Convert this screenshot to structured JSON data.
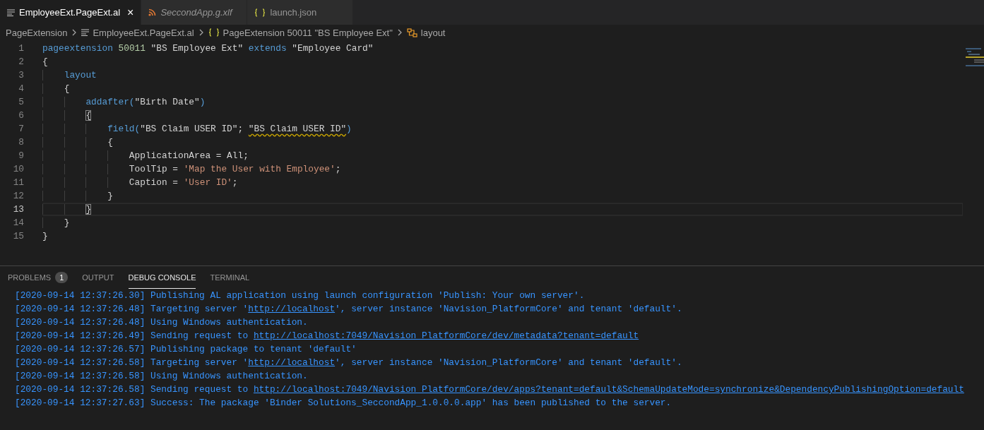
{
  "tabs": [
    {
      "kind": "lines",
      "label": "EmployeeExt.PageExt.al",
      "selected": true,
      "preview": false,
      "close": "×"
    },
    {
      "kind": "rss",
      "label": "SeccondApp.g.xlf",
      "selected": false,
      "preview": true
    },
    {
      "kind": "braces",
      "label": "launch.json",
      "selected": false,
      "preview": false
    }
  ],
  "breadcrumbs": [
    {
      "kind": "plain",
      "label": "PageExtension"
    },
    {
      "kind": "lines",
      "label": "EmployeeExt.PageExt.al"
    },
    {
      "kind": "braces",
      "label": "PageExtension 50011 \"BS Employee Ext\""
    },
    {
      "kind": "tree",
      "label": "layout"
    }
  ],
  "editor": {
    "lines": [
      {
        "number": "1",
        "current": false,
        "tokens": [
          {
            "kind": "keyword",
            "text": "pageextension"
          },
          {
            "kind": "number",
            "text": " 50011"
          },
          {
            "kind": "plain",
            "text": " \"BS Employee Ext\" "
          },
          {
            "kind": "keyword",
            "text": "extends"
          },
          {
            "kind": "plain",
            "text": " \"Employee Card\""
          }
        ]
      },
      {
        "number": "2",
        "current": false,
        "tokens": [
          {
            "kind": "plain",
            "text": "{"
          }
        ]
      },
      {
        "number": "3",
        "current": false,
        "tokens": [
          {
            "kind": "keyword",
            "text": "    layout"
          }
        ]
      },
      {
        "number": "4",
        "current": false,
        "tokens": [
          {
            "kind": "plain",
            "text": "    {"
          }
        ]
      },
      {
        "number": "5",
        "current": false,
        "tokens": [
          {
            "kind": "keyword",
            "text": "        addafter("
          },
          {
            "kind": "plain",
            "text": "\"Birth Date\""
          },
          {
            "kind": "keyword",
            "text": ")"
          }
        ]
      },
      {
        "number": "6",
        "current": false,
        "tokens": [
          {
            "kind": "match",
            "text": "        {"
          }
        ]
      },
      {
        "number": "7",
        "current": false,
        "tokens": [
          {
            "kind": "keyword",
            "text": "            field("
          },
          {
            "kind": "plain",
            "text": "\"BS Claim USER ID\"; "
          },
          {
            "kind": "warning",
            "text": "\"BS Claim USER ID\""
          },
          {
            "kind": "keyword",
            "text": ")"
          }
        ]
      },
      {
        "number": "8",
        "current": false,
        "tokens": [
          {
            "kind": "plain",
            "text": "            {"
          }
        ]
      },
      {
        "number": "9",
        "current": false,
        "tokens": [
          {
            "kind": "plain",
            "text": "                ApplicationArea = All;"
          }
        ]
      },
      {
        "number": "10",
        "current": false,
        "tokens": [
          {
            "kind": "plain",
            "text": "                ToolTip = "
          },
          {
            "kind": "string",
            "text": "'Map the User with Employee'"
          },
          {
            "kind": "plain",
            "text": ";"
          }
        ]
      },
      {
        "number": "11",
        "current": false,
        "tokens": [
          {
            "kind": "plain",
            "text": "                Caption = "
          },
          {
            "kind": "string",
            "text": "'User ID'"
          },
          {
            "kind": "plain",
            "text": ";"
          }
        ]
      },
      {
        "number": "12",
        "current": false,
        "tokens": [
          {
            "kind": "plain",
            "text": "            }"
          }
        ]
      },
      {
        "number": "13",
        "current": true,
        "tokens": [
          {
            "kind": "match",
            "text": "        }"
          }
        ]
      },
      {
        "number": "14",
        "current": false,
        "tokens": [
          {
            "kind": "plain",
            "text": "    }"
          }
        ]
      },
      {
        "number": "15",
        "current": false,
        "tokens": [
          {
            "kind": "plain",
            "text": "}"
          }
        ]
      }
    ]
  },
  "panel": {
    "tabs": [
      {
        "label": "PROBLEMS",
        "badge": "1",
        "selected": false
      },
      {
        "label": "OUTPUT",
        "selected": false
      },
      {
        "label": "DEBUG CONSOLE",
        "selected": true
      },
      {
        "label": "TERMINAL",
        "selected": false
      }
    ],
    "console": [
      {
        "parts": [
          {
            "kind": "text",
            "text": "[2020-09-14 12:37:26.30] Publishing AL application using launch configuration 'Publish: Your own server'."
          }
        ]
      },
      {
        "parts": [
          {
            "kind": "text",
            "text": "[2020-09-14 12:37:26.48] Targeting server '"
          },
          {
            "kind": "link",
            "text": "http://localhost"
          },
          {
            "kind": "text",
            "text": "', server instance 'Navision_PlatformCore' and tenant 'default'."
          }
        ]
      },
      {
        "parts": [
          {
            "kind": "text",
            "text": "[2020-09-14 12:37:26.48] Using Windows authentication."
          }
        ]
      },
      {
        "parts": [
          {
            "kind": "text",
            "text": "[2020-09-14 12:37:26.49] Sending request to "
          },
          {
            "kind": "link",
            "text": "http://localhost:7049/Navision_PlatformCore/dev/metadata?tenant=default"
          }
        ]
      },
      {
        "parts": [
          {
            "kind": "text",
            "text": "[2020-09-14 12:37:26.57] Publishing package to tenant 'default'"
          }
        ]
      },
      {
        "parts": [
          {
            "kind": "text",
            "text": "[2020-09-14 12:37:26.58] Targeting server '"
          },
          {
            "kind": "link",
            "text": "http://localhost"
          },
          {
            "kind": "text",
            "text": "', server instance 'Navision_PlatformCore' and tenant 'default'."
          }
        ]
      },
      {
        "parts": [
          {
            "kind": "text",
            "text": "[2020-09-14 12:37:26.58] Using Windows authentication."
          }
        ]
      },
      {
        "parts": [
          {
            "kind": "text",
            "text": "[2020-09-14 12:37:26.58] Sending request to "
          },
          {
            "kind": "link",
            "text": "http://localhost:7049/Navision_PlatformCore/dev/apps?tenant=default&SchemaUpdateMode=synchronize&DependencyPublishingOption=default"
          }
        ]
      },
      {
        "parts": [
          {
            "kind": "text",
            "text": "[2020-09-14 12:37:27.63] Success: The package 'Binder Solutions_SeccondApp_1.0.0.0.app' has been published to the server."
          }
        ]
      }
    ]
  }
}
